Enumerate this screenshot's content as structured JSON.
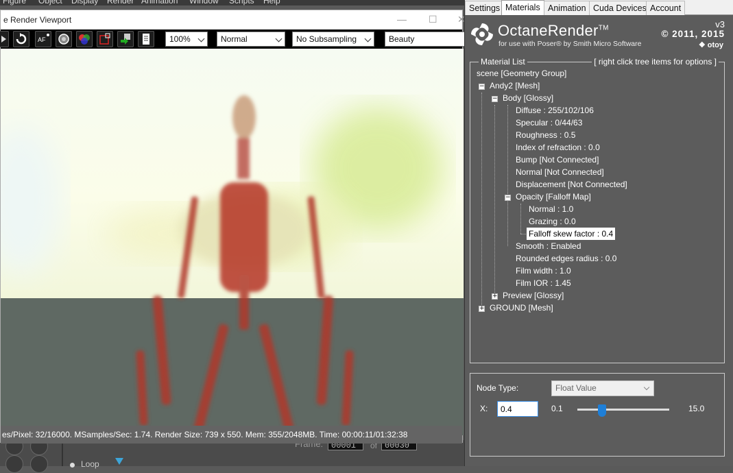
{
  "poser": {
    "menu": [
      "Figure",
      "Object",
      "Display",
      "Render",
      "Animation",
      "Window",
      "Scripts",
      "Help"
    ],
    "frame_label": "Frame:",
    "frame_value": "00001",
    "of_label": "of",
    "frame_total": "00030",
    "loop_label": "Loop"
  },
  "viewport": {
    "title": "e Render Viewport",
    "zoom": "100%",
    "mode": "Normal",
    "subsampling": "No Subsampling",
    "pass": "Beauty",
    "status": "es/Pixel: 32/16000. MSamples/Sec: 1.74. Render Size: 739 x 550. Mem: 355/2048MB. Time: 00:00:11/01:32:38",
    "toolbar_icons": [
      "play-icon",
      "restart-icon",
      "autofocus-icon",
      "camera-icon",
      "color-wheel-icon",
      "region-icon",
      "export-icon",
      "document-icon"
    ]
  },
  "octane": {
    "tabs": [
      "Settings",
      "Materials",
      "Animation",
      "Cuda Devices",
      "Account"
    ],
    "active_tab": "Materials",
    "brand_name": "OctaneRender",
    "brand_tm": "TM",
    "brand_sub": "for use with Poser® by Smith Micro Software",
    "version": "v3",
    "copyright": "© 2011, 2015",
    "otoy": "otoy",
    "material_list_label": "Material List",
    "hint": "[ right click tree items for options ]",
    "tree": [
      {
        "text": "scene   [Geometry Group]"
      },
      {
        "text": "Andy2   [Mesh]"
      },
      {
        "text": "Body   [Glossy]"
      },
      {
        "text": "Diffuse  :  255/102/106"
      },
      {
        "text": "Specular  :  0/44/63"
      },
      {
        "text": "Roughness  :  0.5"
      },
      {
        "text": "Index of refraction  :  0.0"
      },
      {
        "text": "Bump   [Not Connected]"
      },
      {
        "text": "Normal   [Not Connected]"
      },
      {
        "text": "Displacement   [Not Connected]"
      },
      {
        "text": "Opacity   [Falloff Map]"
      },
      {
        "text": "Normal  :  1.0"
      },
      {
        "text": "Grazing  :  0.0"
      },
      {
        "text": "Falloff skew factor  :  0.4"
      },
      {
        "text": "Smooth  :  Enabled"
      },
      {
        "text": "Rounded edges radius  :  0.0"
      },
      {
        "text": "Film width  :  1.0"
      },
      {
        "text": "Film IOR  :  1.45"
      },
      {
        "text": "Preview   [Glossy]"
      },
      {
        "text": "GROUND   [Mesh]"
      }
    ],
    "node": {
      "type_label": "Node Type:",
      "type_value": "Float Value",
      "x_label": "X:",
      "x_value": "0.4",
      "min": "0.1",
      "max": "15.0",
      "slider_fraction": 0.27
    }
  }
}
